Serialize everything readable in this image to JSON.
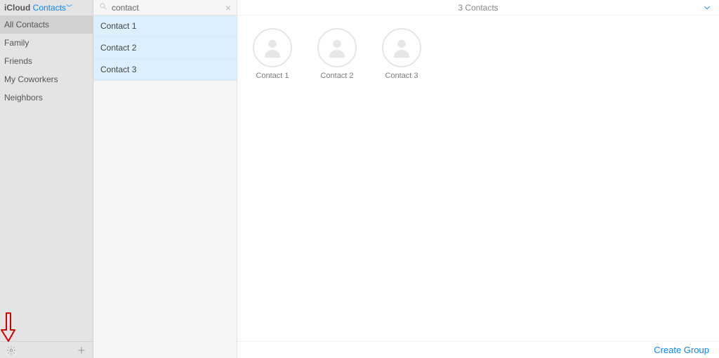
{
  "header": {
    "brand": "iCloud",
    "section": "Contacts"
  },
  "sidebar": {
    "groups": [
      {
        "label": "All Contacts",
        "active": true
      },
      {
        "label": "Family",
        "active": false
      },
      {
        "label": "Friends",
        "active": false
      },
      {
        "label": "My Coworkers",
        "active": false
      },
      {
        "label": "Neighbors",
        "active": false
      }
    ]
  },
  "search": {
    "value": "contact"
  },
  "list": {
    "items": [
      {
        "label": "Contact 1",
        "selected": true
      },
      {
        "label": "Contact 2",
        "selected": true
      },
      {
        "label": "Contact 3",
        "selected": true
      }
    ]
  },
  "detail": {
    "title": "3 Contacts",
    "cards": [
      {
        "label": "Contact 1"
      },
      {
        "label": "Contact 2"
      },
      {
        "label": "Contact 3"
      }
    ],
    "footer_link": "Create Group"
  }
}
